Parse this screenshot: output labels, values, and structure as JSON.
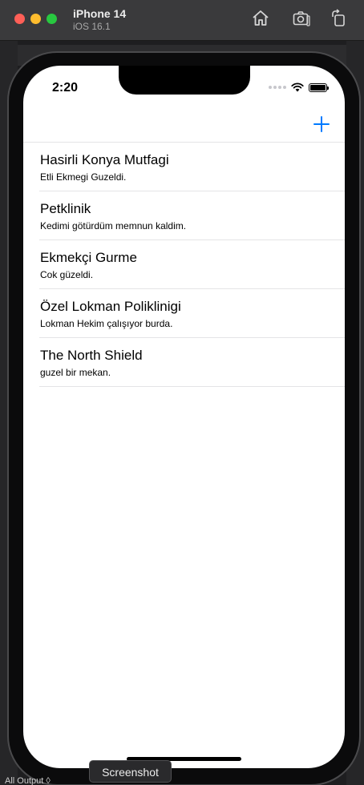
{
  "window": {
    "device_name": "iPhone 14",
    "os_version": "iOS 16.1"
  },
  "toolbar": {
    "home_icon": "home-icon",
    "screenshot_icon": "camera-icon",
    "rotate_icon": "rotate-icon"
  },
  "status_bar": {
    "time": "2:20"
  },
  "navbar": {
    "add_icon": "plus-icon",
    "accent_color": "#007aff"
  },
  "places": [
    {
      "title": "Hasirli Konya Mutfagi",
      "subtitle": "Etli Ekmegi Guzeldi."
    },
    {
      "title": "Petklinik",
      "subtitle": "Kedimi götürdüm memnun kaldim."
    },
    {
      "title": "Ekmekçi Gurme",
      "subtitle": "Cok güzeldi."
    },
    {
      "title": "Özel Lokman Poliklinigi",
      "subtitle": "Lokman Hekim çalışıyor burda."
    },
    {
      "title": "The North Shield",
      "subtitle": "guzel bir mekan."
    }
  ],
  "tooltip": {
    "text": "Screenshot"
  },
  "bottom": {
    "output_label": "All Output ◊"
  }
}
